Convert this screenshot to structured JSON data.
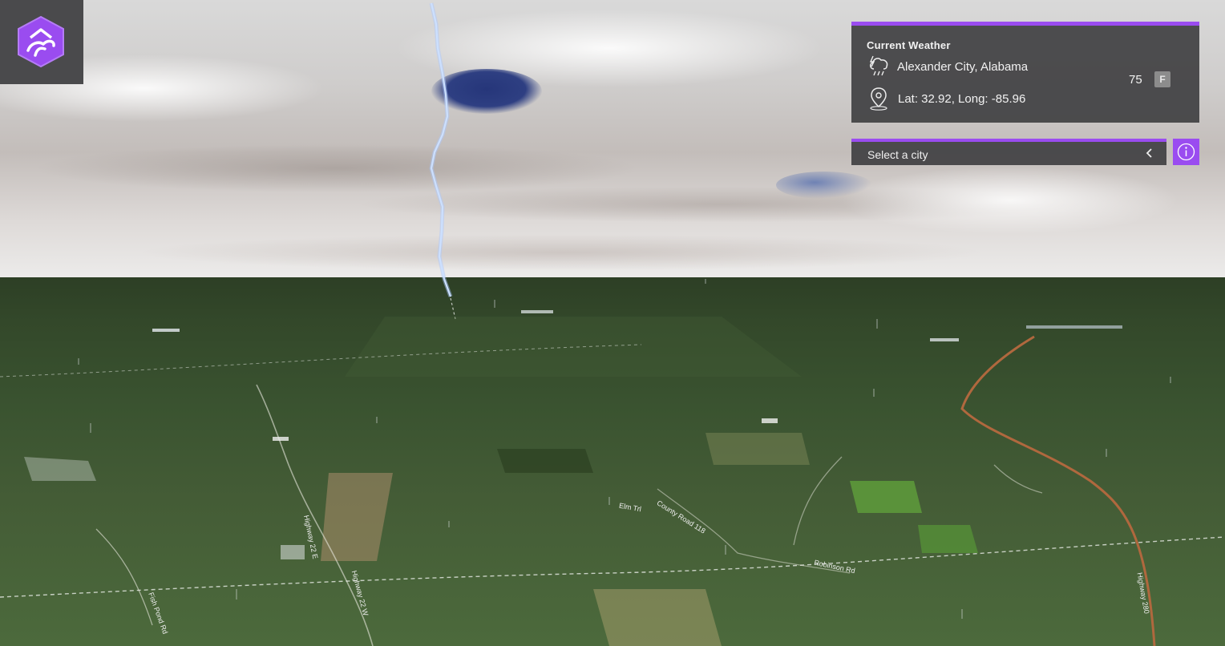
{
  "app": {
    "logo_icon": "tree-hexagon-logo-icon",
    "accent_color": "#9a4cf0"
  },
  "weather": {
    "title": "Current Weather",
    "condition_icon": "thunderstorm-icon",
    "city": "Alexander City, Alabama",
    "location_icon": "map-pin-icon",
    "coordinates": "Lat: 32.92, Long: -85.96",
    "temperature": "75",
    "unit": "F"
  },
  "city_select": {
    "label": "Select a city",
    "chevron_icon": "chevron-left-icon"
  },
  "info_button": {
    "icon": "info-icon"
  },
  "map_labels": [
    "Highway 22 E",
    "Highway 22 W",
    "Elm Trl",
    "County Road 118",
    "Robinson Rd",
    "Highway 280",
    "Fish Pond Rd"
  ]
}
